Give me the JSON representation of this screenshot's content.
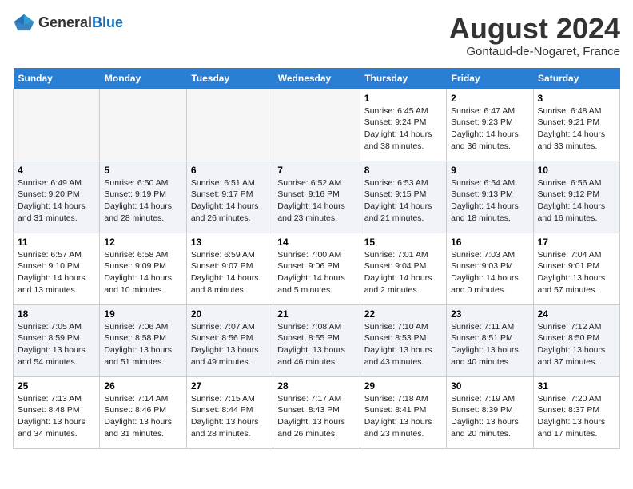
{
  "header": {
    "logo_general": "General",
    "logo_blue": "Blue",
    "month_year": "August 2024",
    "location": "Gontaud-de-Nogaret, France"
  },
  "days_of_week": [
    "Sunday",
    "Monday",
    "Tuesday",
    "Wednesday",
    "Thursday",
    "Friday",
    "Saturday"
  ],
  "weeks": [
    [
      {
        "day": "",
        "empty": true
      },
      {
        "day": "",
        "empty": true
      },
      {
        "day": "",
        "empty": true
      },
      {
        "day": "",
        "empty": true
      },
      {
        "day": "1",
        "sunrise": "6:45 AM",
        "sunset": "9:24 PM",
        "daylight": "14 hours and 38 minutes."
      },
      {
        "day": "2",
        "sunrise": "6:47 AM",
        "sunset": "9:23 PM",
        "daylight": "14 hours and 36 minutes."
      },
      {
        "day": "3",
        "sunrise": "6:48 AM",
        "sunset": "9:21 PM",
        "daylight": "14 hours and 33 minutes."
      }
    ],
    [
      {
        "day": "4",
        "sunrise": "6:49 AM",
        "sunset": "9:20 PM",
        "daylight": "14 hours and 31 minutes."
      },
      {
        "day": "5",
        "sunrise": "6:50 AM",
        "sunset": "9:19 PM",
        "daylight": "14 hours and 28 minutes."
      },
      {
        "day": "6",
        "sunrise": "6:51 AM",
        "sunset": "9:17 PM",
        "daylight": "14 hours and 26 minutes."
      },
      {
        "day": "7",
        "sunrise": "6:52 AM",
        "sunset": "9:16 PM",
        "daylight": "14 hours and 23 minutes."
      },
      {
        "day": "8",
        "sunrise": "6:53 AM",
        "sunset": "9:15 PM",
        "daylight": "14 hours and 21 minutes."
      },
      {
        "day": "9",
        "sunrise": "6:54 AM",
        "sunset": "9:13 PM",
        "daylight": "14 hours and 18 minutes."
      },
      {
        "day": "10",
        "sunrise": "6:56 AM",
        "sunset": "9:12 PM",
        "daylight": "14 hours and 16 minutes."
      }
    ],
    [
      {
        "day": "11",
        "sunrise": "6:57 AM",
        "sunset": "9:10 PM",
        "daylight": "14 hours and 13 minutes."
      },
      {
        "day": "12",
        "sunrise": "6:58 AM",
        "sunset": "9:09 PM",
        "daylight": "14 hours and 10 minutes."
      },
      {
        "day": "13",
        "sunrise": "6:59 AM",
        "sunset": "9:07 PM",
        "daylight": "14 hours and 8 minutes."
      },
      {
        "day": "14",
        "sunrise": "7:00 AM",
        "sunset": "9:06 PM",
        "daylight": "14 hours and 5 minutes."
      },
      {
        "day": "15",
        "sunrise": "7:01 AM",
        "sunset": "9:04 PM",
        "daylight": "14 hours and 2 minutes."
      },
      {
        "day": "16",
        "sunrise": "7:03 AM",
        "sunset": "9:03 PM",
        "daylight": "14 hours and 0 minutes."
      },
      {
        "day": "17",
        "sunrise": "7:04 AM",
        "sunset": "9:01 PM",
        "daylight": "13 hours and 57 minutes."
      }
    ],
    [
      {
        "day": "18",
        "sunrise": "7:05 AM",
        "sunset": "8:59 PM",
        "daylight": "13 hours and 54 minutes."
      },
      {
        "day": "19",
        "sunrise": "7:06 AM",
        "sunset": "8:58 PM",
        "daylight": "13 hours and 51 minutes."
      },
      {
        "day": "20",
        "sunrise": "7:07 AM",
        "sunset": "8:56 PM",
        "daylight": "13 hours and 49 minutes."
      },
      {
        "day": "21",
        "sunrise": "7:08 AM",
        "sunset": "8:55 PM",
        "daylight": "13 hours and 46 minutes."
      },
      {
        "day": "22",
        "sunrise": "7:10 AM",
        "sunset": "8:53 PM",
        "daylight": "13 hours and 43 minutes."
      },
      {
        "day": "23",
        "sunrise": "7:11 AM",
        "sunset": "8:51 PM",
        "daylight": "13 hours and 40 minutes."
      },
      {
        "day": "24",
        "sunrise": "7:12 AM",
        "sunset": "8:50 PM",
        "daylight": "13 hours and 37 minutes."
      }
    ],
    [
      {
        "day": "25",
        "sunrise": "7:13 AM",
        "sunset": "8:48 PM",
        "daylight": "13 hours and 34 minutes."
      },
      {
        "day": "26",
        "sunrise": "7:14 AM",
        "sunset": "8:46 PM",
        "daylight": "13 hours and 31 minutes."
      },
      {
        "day": "27",
        "sunrise": "7:15 AM",
        "sunset": "8:44 PM",
        "daylight": "13 hours and 28 minutes."
      },
      {
        "day": "28",
        "sunrise": "7:17 AM",
        "sunset": "8:43 PM",
        "daylight": "13 hours and 26 minutes."
      },
      {
        "day": "29",
        "sunrise": "7:18 AM",
        "sunset": "8:41 PM",
        "daylight": "13 hours and 23 minutes."
      },
      {
        "day": "30",
        "sunrise": "7:19 AM",
        "sunset": "8:39 PM",
        "daylight": "13 hours and 20 minutes."
      },
      {
        "day": "31",
        "sunrise": "7:20 AM",
        "sunset": "8:37 PM",
        "daylight": "13 hours and 17 minutes."
      }
    ]
  ]
}
